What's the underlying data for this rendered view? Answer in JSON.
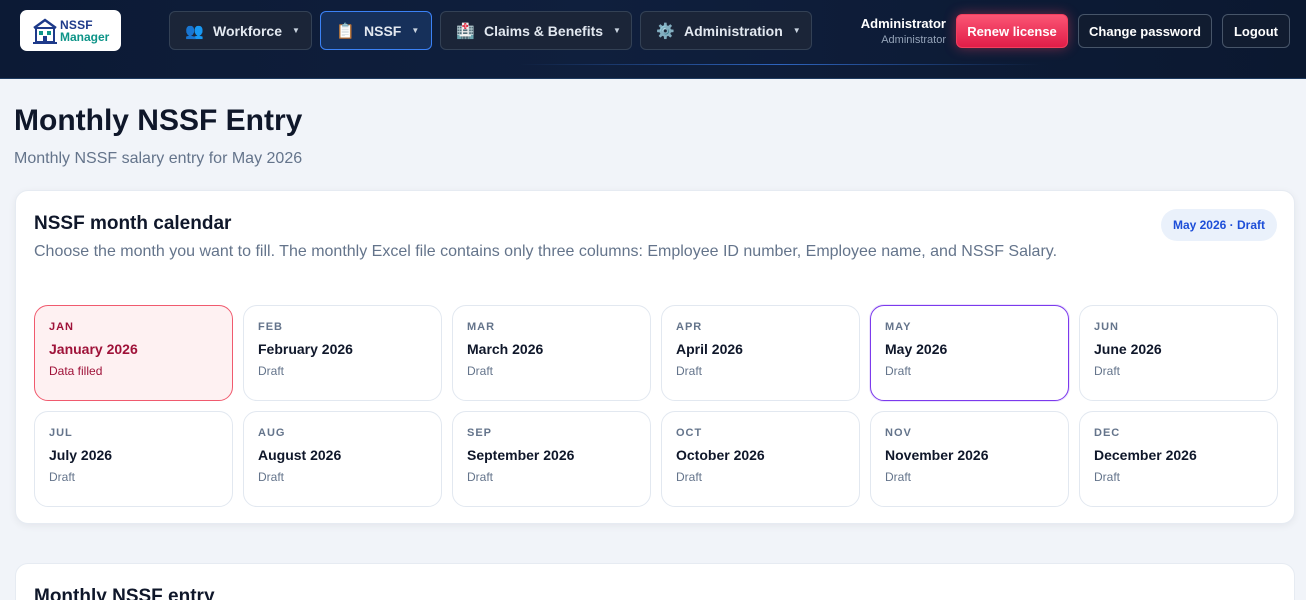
{
  "app": {
    "logo_line1": "NSSF",
    "logo_line2": "Manager"
  },
  "nav": [
    {
      "icon": "👥",
      "icon_name": "people-icon",
      "label": "Workforce"
    },
    {
      "icon": "📋",
      "icon_name": "clipboard-icon",
      "label": "NSSF"
    },
    {
      "icon": "🏥",
      "icon_name": "hospital-icon",
      "label": "Claims & Benefits"
    },
    {
      "icon": "⚙️",
      "icon_name": "gear-icon",
      "label": "Administration"
    }
  ],
  "user": {
    "name": "Administrator",
    "role": "Administrator"
  },
  "header_buttons": {
    "renew": "Renew license",
    "change_password": "Change password",
    "logout": "Logout"
  },
  "page": {
    "title": "Monthly NSSF Entry",
    "subtitle": "Monthly NSSF salary entry for May 2026"
  },
  "calendar": {
    "title": "NSSF month calendar",
    "description": "Choose the month you want to fill. The monthly Excel file contains only three columns: Employee ID number, Employee name, and NSSF Salary.",
    "status": "May 2026 · Draft",
    "months": [
      {
        "abbr": "JAN",
        "name": "January 2026",
        "status": "Data filled"
      },
      {
        "abbr": "FEB",
        "name": "February 2026",
        "status": "Draft"
      },
      {
        "abbr": "MAR",
        "name": "March 2026",
        "status": "Draft"
      },
      {
        "abbr": "APR",
        "name": "April 2026",
        "status": "Draft"
      },
      {
        "abbr": "MAY",
        "name": "May 2026",
        "status": "Draft"
      },
      {
        "abbr": "JUN",
        "name": "June 2026",
        "status": "Draft"
      },
      {
        "abbr": "JUL",
        "name": "July 2026",
        "status": "Draft"
      },
      {
        "abbr": "AUG",
        "name": "August 2026",
        "status": "Draft"
      },
      {
        "abbr": "SEP",
        "name": "September 2026",
        "status": "Draft"
      },
      {
        "abbr": "OCT",
        "name": "October 2026",
        "status": "Draft"
      },
      {
        "abbr": "NOV",
        "name": "November 2026",
        "status": "Draft"
      },
      {
        "abbr": "DEC",
        "name": "December 2026",
        "status": "Draft"
      }
    ]
  },
  "entry": {
    "title": "Monthly NSSF entry"
  },
  "colors": {
    "accent": "#e11d48",
    "selected": "#7c3aed",
    "filled_bg": "#fef1f2",
    "header_bg": "#0f1f3d"
  }
}
